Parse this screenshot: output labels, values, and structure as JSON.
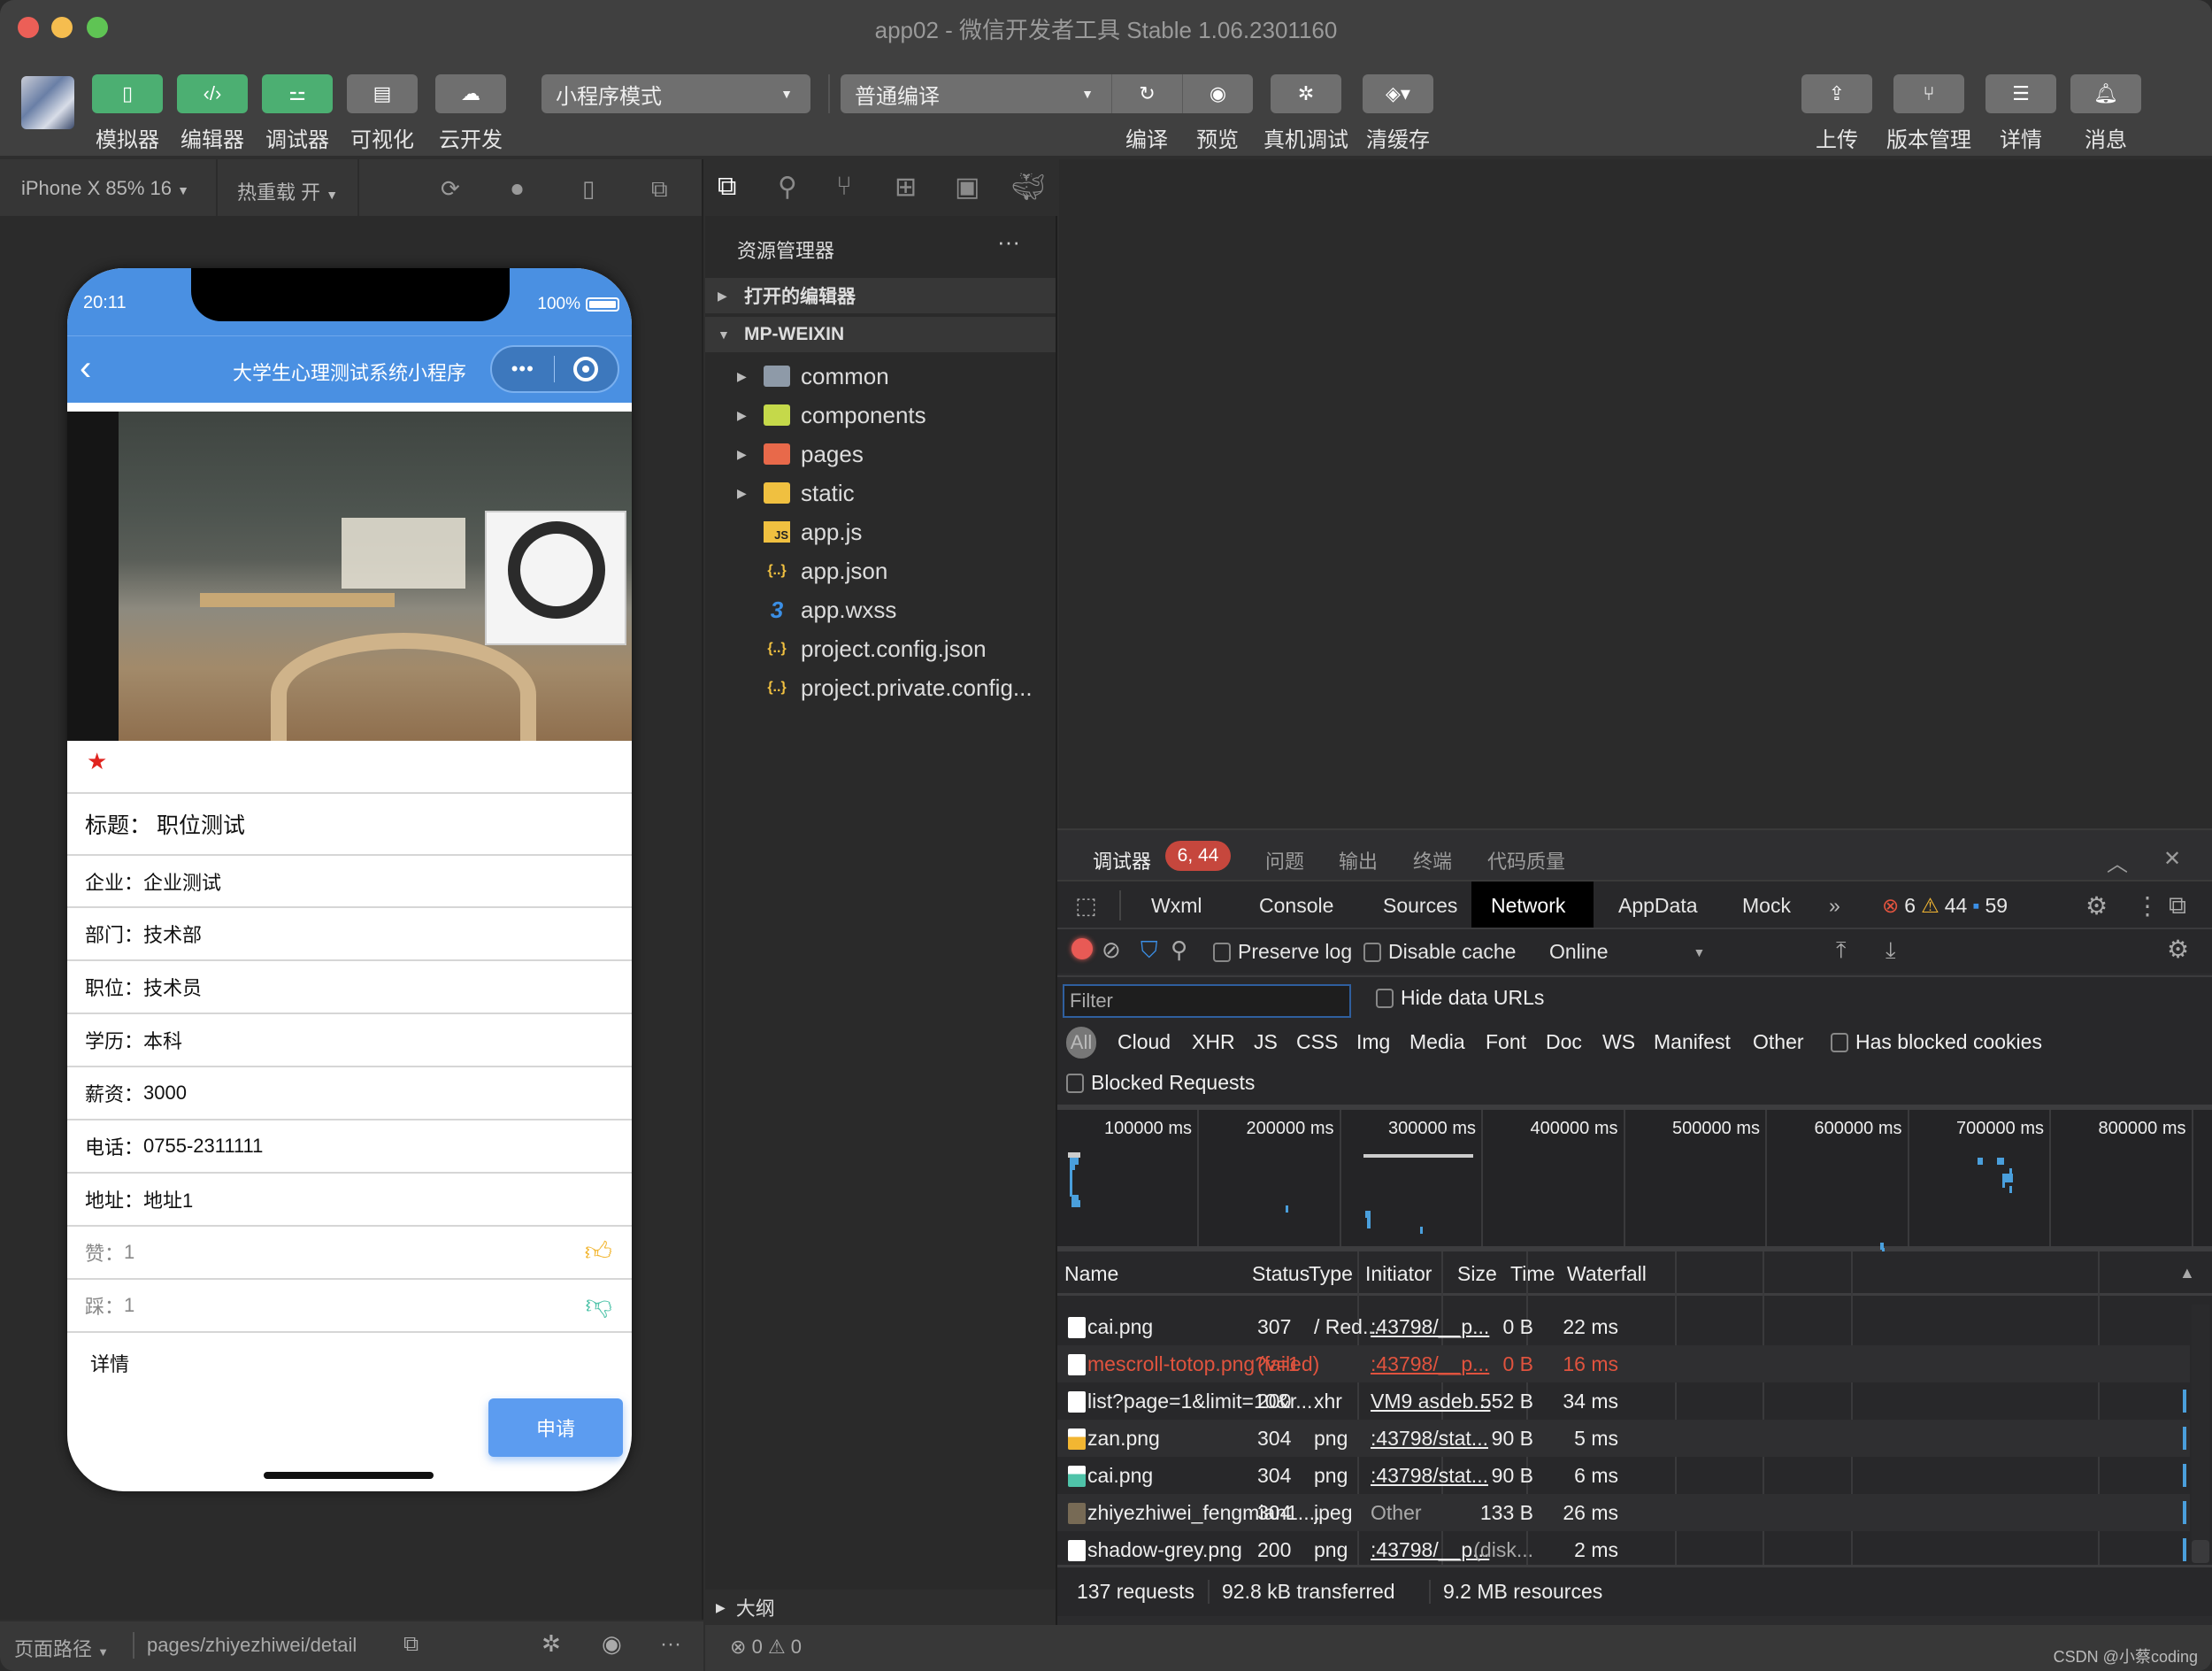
{
  "window": {
    "title": "app02 - 微信开发者工具 Stable 1.06.2301160"
  },
  "toolbar": {
    "left_buttons": [
      {
        "label": "模拟器",
        "icon": "phone-icon",
        "active": true
      },
      {
        "label": "编辑器",
        "icon": "code-icon",
        "active": true
      },
      {
        "label": "调试器",
        "icon": "debug-sliders-icon",
        "active": true
      },
      {
        "label": "可视化",
        "icon": "layout-icon",
        "active": false
      },
      {
        "label": "云开发",
        "icon": "cloud-icon",
        "active": false
      }
    ],
    "mode_select": "小程序模式",
    "compile_select": "普通编译",
    "actions": [
      {
        "label": "编译",
        "icon": "refresh-icon"
      },
      {
        "label": "预览",
        "icon": "eye-icon"
      },
      {
        "label": "真机调试",
        "icon": "bug-icon"
      },
      {
        "label": "清缓存",
        "icon": "layers-icon"
      }
    ],
    "right_buttons": [
      {
        "label": "上传",
        "icon": "upload-icon"
      },
      {
        "label": "版本管理",
        "icon": "branch-icon"
      },
      {
        "label": "详情",
        "icon": "menu-icon"
      },
      {
        "label": "消息",
        "icon": "bell-icon"
      }
    ]
  },
  "simulator": {
    "device_select": "iPhone X 85% 16",
    "hot_reload": "热重载 开",
    "status_time": "20:11",
    "battery": "100%",
    "nav_title": "大学生心理测试系统小程序",
    "capsule_more": "•••",
    "fields": [
      {
        "label": "标题：",
        "value": "职位测试"
      },
      {
        "label": "企业：",
        "value": "企业测试"
      },
      {
        "label": "部门：",
        "value": "技术部"
      },
      {
        "label": "职位：",
        "value": "技术员"
      },
      {
        "label": "学历：",
        "value": "本科"
      },
      {
        "label": "薪资：",
        "value": "3000"
      },
      {
        "label": "电话：",
        "value": "0755-2311111"
      },
      {
        "label": "地址：",
        "value": "地址1"
      }
    ],
    "like": {
      "label": "赞：",
      "value": "1"
    },
    "dislike": {
      "label": "踩：",
      "value": "1"
    },
    "detail_label": "详情",
    "apply_button": "申请",
    "star": "★",
    "accent": "#4a90e2"
  },
  "explorer": {
    "title": "资源管理器",
    "more": "···",
    "open_editors": "打开的编辑器",
    "project": "MP-WEIXIN",
    "items": [
      {
        "name": "common",
        "type": "folder",
        "icon": "folder-icon",
        "color": "#8e9aa8"
      },
      {
        "name": "components",
        "type": "folder",
        "icon": "components-folder-icon",
        "color": "#c5d94a"
      },
      {
        "name": "pages",
        "type": "folder",
        "icon": "pages-folder-icon",
        "color": "#e8694a"
      },
      {
        "name": "static",
        "type": "folder",
        "icon": "static-folder-icon",
        "color": "#f0c040"
      },
      {
        "name": "app.js",
        "type": "file",
        "icon": "js-file-icon",
        "glyph": "JS"
      },
      {
        "name": "app.json",
        "type": "file",
        "icon": "json-file-icon",
        "glyph": "{..}"
      },
      {
        "name": "app.wxss",
        "type": "file",
        "icon": "css-file-icon",
        "glyph": "3"
      },
      {
        "name": "project.config.json",
        "type": "file",
        "icon": "json-file-icon",
        "glyph": "{..}"
      },
      {
        "name": "project.private.config...",
        "type": "file",
        "icon": "json-file-icon",
        "glyph": "{..}"
      }
    ],
    "outline": "大纲"
  },
  "devtools": {
    "panel_tabs": [
      "调试器",
      "问题",
      "输出",
      "终端",
      "代码质量"
    ],
    "panel_badge": "6, 44",
    "tabs": [
      "Wxml",
      "Console",
      "Sources",
      "Network",
      "AppData",
      "Mock"
    ],
    "active_tab": "Network",
    "more_tabs": "»",
    "counts": {
      "errors": "6",
      "warnings": "44",
      "messages": "59"
    },
    "network_toolbar": {
      "preserve_log": "Preserve log",
      "disable_cache": "Disable cache",
      "throttle": "Online"
    },
    "filter_placeholder": "Filter",
    "hide_data_urls": "Hide data URLs",
    "type_filters": [
      "All",
      "Cloud",
      "XHR",
      "JS",
      "CSS",
      "Img",
      "Media",
      "Font",
      "Doc",
      "WS",
      "Manifest",
      "Other"
    ],
    "has_blocked_cookies": "Has blocked cookies",
    "blocked_requests": "Blocked Requests",
    "timeline_ticks": [
      "100000 ms",
      "200000 ms",
      "300000 ms",
      "400000 ms",
      "500000 ms",
      "600000 ms",
      "700000 ms",
      "800000 ms"
    ],
    "columns": [
      "Name",
      "Status",
      "Type",
      "Initiator",
      "Size",
      "Time",
      "Waterfall"
    ],
    "rows": [
      {
        "name": "cai.png",
        "status": "307",
        "type": "/ Red...",
        "initiator": ":43798/__p...",
        "size": "0 B",
        "time": "22 ms",
        "error": false
      },
      {
        "name": "mescroll-totop.png?v=1",
        "status": "(failed)",
        "type": "",
        "initiator": ":43798/__p...",
        "size": "0 B",
        "time": "16 ms",
        "error": true
      },
      {
        "name": "list?page=1&limit=10&r...",
        "status": "200",
        "type": "xhr",
        "initiator": "VM9 asdeb...",
        "size": "552 B",
        "time": "34 ms",
        "error": false
      },
      {
        "name": "zan.png",
        "status": "304",
        "type": "png",
        "initiator": ":43798/stat...",
        "size": "90 B",
        "time": "5 ms",
        "error": false
      },
      {
        "name": "cai.png",
        "status": "304",
        "type": "png",
        "initiator": ":43798/stat...",
        "size": "90 B",
        "time": "6 ms",
        "error": false
      },
      {
        "name": "zhiyezhiwei_fengmian1....",
        "status": "304",
        "type": "jpeg",
        "initiator": "Other",
        "size": "133 B",
        "time": "26 ms",
        "error": false
      },
      {
        "name": "shadow-grey.png",
        "status": "200",
        "type": "png",
        "initiator": ":43798/__p...",
        "size": "(disk...",
        "time": "2 ms",
        "error": false
      }
    ],
    "summary": {
      "requests": "137 requests",
      "transferred": "92.8 kB transferred",
      "resources": "9.2 MB resources"
    }
  },
  "statusbar": {
    "page_path_label": "页面路径",
    "page_path": "pages/zhiyezhiwei/detail",
    "errors": "0",
    "warnings": "0",
    "watermark": "CSDN @小蔡coding"
  }
}
